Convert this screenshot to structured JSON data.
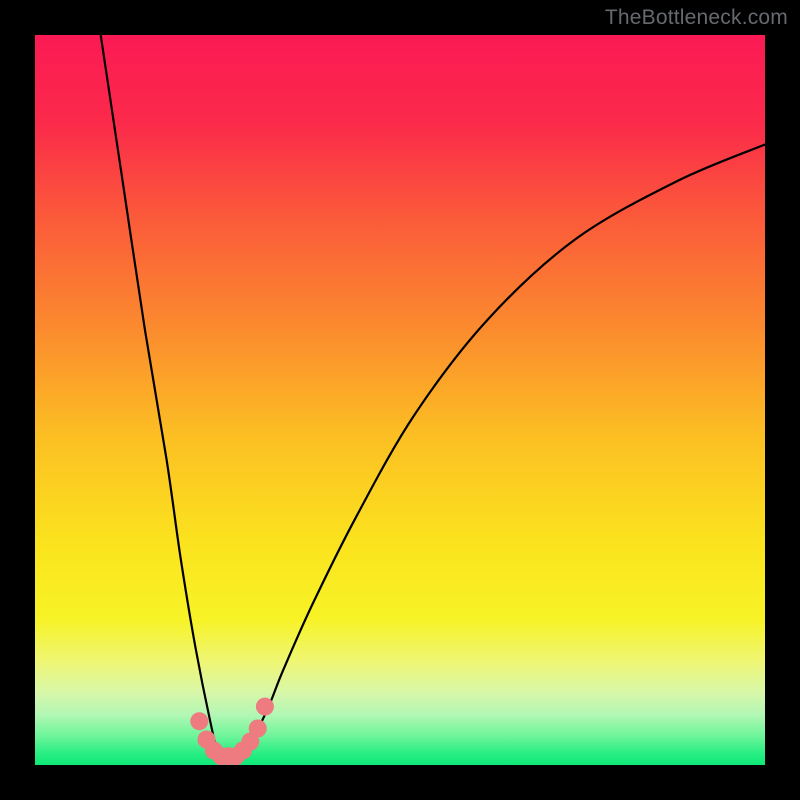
{
  "watermark": "TheBottleneck.com",
  "chart_data": {
    "type": "line",
    "title": "",
    "xlabel": "",
    "ylabel": "",
    "xlim": [
      0,
      100
    ],
    "ylim": [
      0,
      100
    ],
    "grid": false,
    "legend": false,
    "note": "Approximate V-shaped bottleneck curve and gradient background as read from image. Values are percentages of plot dimensions (origin at bottom-left).",
    "series": [
      {
        "name": "bottleneck-curve",
        "x": [
          9,
          12,
          15,
          18,
          20,
          22,
          24,
          25,
          26,
          27,
          28,
          30,
          32,
          34,
          38,
          44,
          52,
          62,
          74,
          88,
          100
        ],
        "y": [
          100,
          80,
          60,
          42,
          28,
          16,
          6,
          2,
          1,
          1,
          2,
          4,
          8,
          13,
          22,
          34,
          48,
          61,
          72,
          80,
          85
        ]
      },
      {
        "name": "near-minimum-marker-band",
        "x": [
          22.5,
          23.5,
          24.5,
          25.5,
          26.5,
          27.5,
          28.5,
          29.5,
          30.5,
          31.5
        ],
        "y": [
          6,
          3.5,
          2,
          1.2,
          1.2,
          1.2,
          2,
          3.2,
          5,
          8
        ]
      }
    ],
    "gradient_stops": [
      {
        "pos": 0.0,
        "color": "#fb1a54"
      },
      {
        "pos": 0.12,
        "color": "#fb2a4a"
      },
      {
        "pos": 0.25,
        "color": "#fb5a3a"
      },
      {
        "pos": 0.4,
        "color": "#fb8a2e"
      },
      {
        "pos": 0.55,
        "color": "#fcbf23"
      },
      {
        "pos": 0.7,
        "color": "#fbe41e"
      },
      {
        "pos": 0.8,
        "color": "#f7f326"
      },
      {
        "pos": 0.86,
        "color": "#eef676"
      },
      {
        "pos": 0.9,
        "color": "#d8f7a8"
      },
      {
        "pos": 0.93,
        "color": "#b4f7b4"
      },
      {
        "pos": 0.96,
        "color": "#6ef59a"
      },
      {
        "pos": 0.985,
        "color": "#26ed82"
      },
      {
        "pos": 1.0,
        "color": "#0fe876"
      }
    ],
    "marker_color": "#ed7b7f"
  }
}
